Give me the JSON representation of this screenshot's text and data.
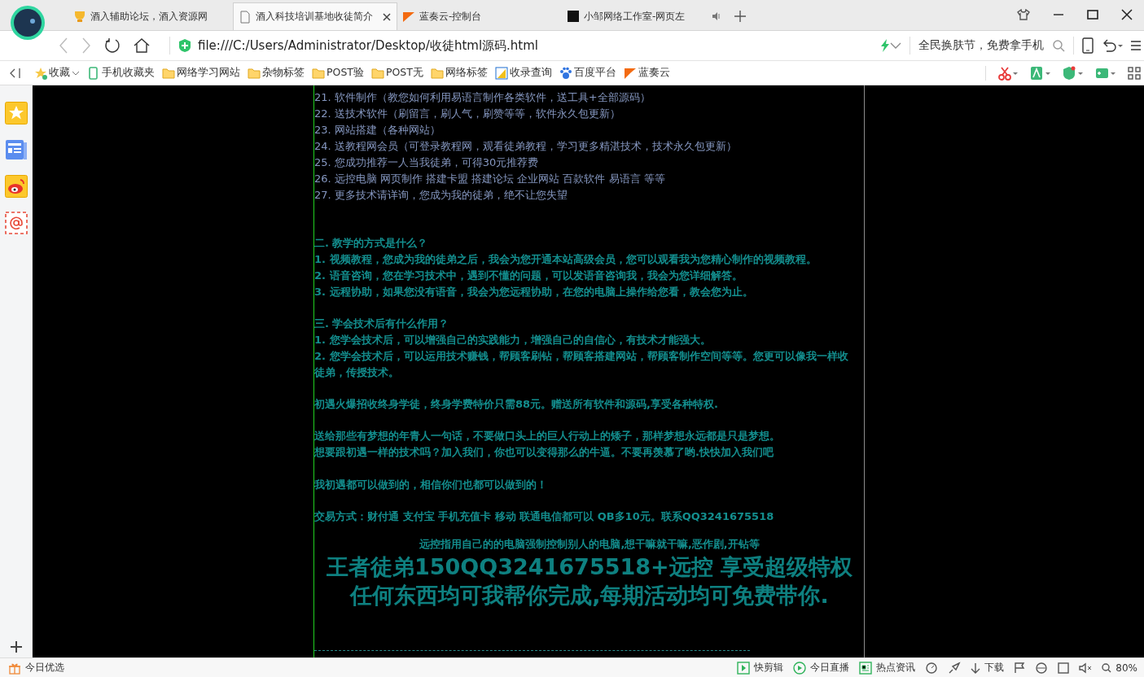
{
  "tabs": [
    {
      "title": "酒入辅助论坛，酒入资源网",
      "selected": false,
      "kind": "trophy",
      "audio": false
    },
    {
      "title": "酒入科技培训基地收徒简介",
      "selected": true,
      "kind": "page",
      "audio": false
    },
    {
      "title": "蓝奏云-控制台",
      "selected": false,
      "kind": "cloud",
      "audio": false
    },
    {
      "title": "小邹网络工作室-网页左",
      "selected": false,
      "kind": "dark",
      "audio": true
    }
  ],
  "address": {
    "url": "file:///C:/Users/Administrator/Desktop/收徒html源码.html",
    "search_placeholder": "全民换肤节，免费拿手机"
  },
  "bookmarks": [
    {
      "label": "收藏",
      "kind": "star"
    },
    {
      "label": "手机收藏夹",
      "kind": "phone"
    },
    {
      "label": "网络学习网站",
      "kind": "folder"
    },
    {
      "label": "杂物标签",
      "kind": "folder"
    },
    {
      "label": "POST验",
      "kind": "folder"
    },
    {
      "label": "POST无",
      "kind": "folder"
    },
    {
      "label": "网络标签",
      "kind": "folder"
    },
    {
      "label": "收录查询",
      "kind": "query"
    },
    {
      "label": "百度平台",
      "kind": "paw"
    },
    {
      "label": "蓝奏云",
      "kind": "cloud"
    }
  ],
  "page": {
    "lines": [
      {
        "kind": "item",
        "text": "21. 软件制作（教您如何利用易语言制作各类软件，送工具+全部源码）"
      },
      {
        "kind": "item",
        "text": "22. 送技术软件（刷留言，刷人气，刷赞等等，软件永久包更新）"
      },
      {
        "kind": "item",
        "text": "23. 网站搭建（各种网站）"
      },
      {
        "kind": "item",
        "text": "24. 送教程网会员（可登录教程网，观看徒弟教程，学习更多精湛技术，技术永久包更新）"
      },
      {
        "kind": "item",
        "text": "25. 您成功推荐一人当我徒弟，可得30元推荐费"
      },
      {
        "kind": "item",
        "text": "26. 远控电脑 网页制作 搭建卡盟 搭建论坛 企业网站 百款软件 易语言 等等"
      },
      {
        "kind": "item",
        "text": "27. 更多技术请详询，您成为我的徒弟，绝不让您失望"
      },
      {
        "kind": "blank"
      },
      {
        "kind": "blank"
      },
      {
        "kind": "text",
        "text": "二. 教学的方式是什么？"
      },
      {
        "kind": "text",
        "text": "1. 视频教程，您成为我的徒弟之后，我会为您开通本站高级会员，您可以观看我为您精心制作的视频教程。"
      },
      {
        "kind": "text",
        "text": "2. 语音咨询，您在学习技术中，遇到不懂的问题，可以发语音咨询我，我会为您详细解答。"
      },
      {
        "kind": "text",
        "text": "3. 远程协助，如果您没有语音，我会为您远程协助，在您的电脑上操作给您看，教会您为止。"
      },
      {
        "kind": "blank"
      },
      {
        "kind": "text",
        "text": "三. 学会技术后有什么作用？"
      },
      {
        "kind": "text",
        "text": "1. 您学会技术后，可以增强自己的实践能力，增强自己的自信心，有技术才能强大。"
      },
      {
        "kind": "text",
        "text": "2. 您学会技术后，可以运用技术赚钱，帮顾客刷钻，帮顾客搭建网站，帮顾客制作空间等等。您更可以像我一样收"
      },
      {
        "kind": "text",
        "text": "徒弟，传授技术。"
      },
      {
        "kind": "blank"
      },
      {
        "kind": "text",
        "text": "初遇火爆招收终身学徒，终身学费特价只需88元。赠送所有软件和源码,享受各种特权."
      },
      {
        "kind": "blank"
      },
      {
        "kind": "text",
        "text": "送给那些有梦想的年青人一句话，不要做口头上的巨人行动上的矮子，那样梦想永远都是只是梦想。"
      },
      {
        "kind": "text",
        "text": "想要跟初遇一样的技术吗？加入我们，你也可以变得那么的牛逼。不要再羡慕了哟.快快加入我们吧"
      },
      {
        "kind": "blank"
      },
      {
        "kind": "text",
        "text": "我初遇都可以做到的，相信你们也都可以做到的！"
      },
      {
        "kind": "blank"
      },
      {
        "kind": "text",
        "text": "交易方式：财付通 支付宝 手机充值卡 移动 联通电信都可以 QB多10元。联系QQ3241675518"
      },
      {
        "kind": "note",
        "text": "远控指用自己的的电脑强制控制别人的电脑,想干嘛就干嘛,恶作剧,开钻等"
      },
      {
        "kind": "headline",
        "text": "王者徒弟150QQ3241675518+远控  享受超级特权"
      },
      {
        "kind": "headline",
        "text": "任何东西均可我帮你完成,每期活动均可免费带你."
      }
    ]
  },
  "status_bar": {
    "left": "今日优选",
    "items": [
      {
        "label": "快剪辑",
        "kind": "clip"
      },
      {
        "label": "今日直播",
        "kind": "live"
      },
      {
        "label": "热点资讯",
        "kind": "news"
      }
    ],
    "download": "下载",
    "zoom": "80%"
  }
}
